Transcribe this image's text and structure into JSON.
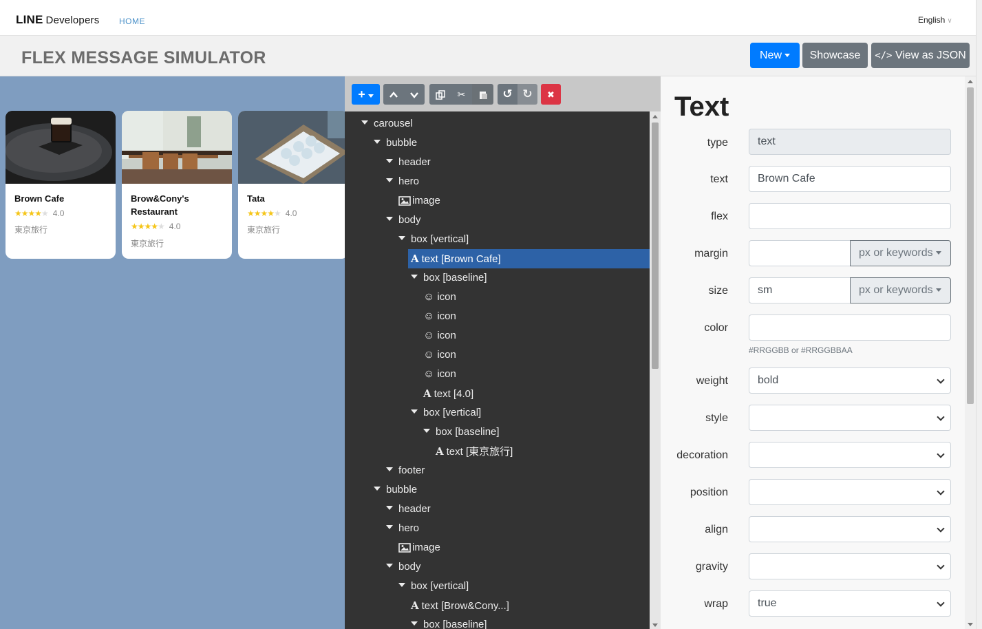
{
  "nav": {
    "brand": "LINE",
    "brand_sub": "Developers",
    "home": "HOME",
    "language": "English"
  },
  "header": {
    "title": "FLEX MESSAGE SIMULATOR",
    "new_label": "New",
    "showcase_label": "Showcase",
    "json_label": "View as JSON"
  },
  "preview": {
    "cards": [
      {
        "name": "Brown Cafe",
        "rating": "4.0",
        "stars_on": 4,
        "place": "東京旅行"
      },
      {
        "name": "Brow&Cony's Restaurant",
        "rating": "4.0",
        "stars_on": 4,
        "place": "東京旅行"
      },
      {
        "name": "Tata",
        "rating": "4.0",
        "stars_on": 4,
        "place": "東京旅行"
      }
    ]
  },
  "toolbar": {
    "add": "+",
    "up": "⌃",
    "down": "⌄",
    "copy": "⧉",
    "cut": "✂",
    "paste": "📋",
    "undo": "↺",
    "redo": "↻",
    "delete": "✖"
  },
  "tree": [
    {
      "label": "carousel",
      "kind": "group",
      "depth": 0
    },
    {
      "label": "bubble",
      "kind": "group",
      "depth": 1
    },
    {
      "label": "header",
      "kind": "group",
      "depth": 2
    },
    {
      "label": "hero",
      "kind": "group",
      "depth": 2
    },
    {
      "label": "image",
      "kind": "image",
      "depth": 3
    },
    {
      "label": "body",
      "kind": "group",
      "depth": 2
    },
    {
      "label": "box [vertical]",
      "kind": "group",
      "depth": 3
    },
    {
      "label": "text [Brown Cafe]",
      "kind": "text",
      "depth": 4,
      "selected": true
    },
    {
      "label": "box [baseline]",
      "kind": "group",
      "depth": 4
    },
    {
      "label": "icon",
      "kind": "icon",
      "depth": 5
    },
    {
      "label": "icon",
      "kind": "icon",
      "depth": 5
    },
    {
      "label": "icon",
      "kind": "icon",
      "depth": 5
    },
    {
      "label": "icon",
      "kind": "icon",
      "depth": 5
    },
    {
      "label": "icon",
      "kind": "icon",
      "depth": 5
    },
    {
      "label": "text [4.0]",
      "kind": "text",
      "depth": 5
    },
    {
      "label": "box [vertical]",
      "kind": "group",
      "depth": 4
    },
    {
      "label": "box [baseline]",
      "kind": "group",
      "depth": 5
    },
    {
      "label": "text [東京旅行]",
      "kind": "text",
      "depth": 6
    },
    {
      "label": "footer",
      "kind": "group",
      "depth": 2
    },
    {
      "label": "bubble",
      "kind": "group",
      "depth": 1
    },
    {
      "label": "header",
      "kind": "group",
      "depth": 2
    },
    {
      "label": "hero",
      "kind": "group",
      "depth": 2
    },
    {
      "label": "image",
      "kind": "image",
      "depth": 3
    },
    {
      "label": "body",
      "kind": "group",
      "depth": 2
    },
    {
      "label": "box [vertical]",
      "kind": "group",
      "depth": 3
    },
    {
      "label": "text [Brow&Cony...]",
      "kind": "text",
      "depth": 4
    },
    {
      "label": "box [baseline]",
      "kind": "group",
      "depth": 4
    }
  ],
  "props": {
    "heading": "Text",
    "type_label": "type",
    "type_value": "text",
    "text_label": "text",
    "text_value": "Brown Cafe",
    "flex_label": "flex",
    "flex_value": "",
    "margin_label": "margin",
    "margin_value": "",
    "margin_unit": "px or keywords",
    "size_label": "size",
    "size_value": "sm",
    "size_unit": "px or keywords",
    "color_label": "color",
    "color_value": "",
    "color_hint": "#RRGGBB or #RRGGBBAA",
    "weight_label": "weight",
    "weight_value": "bold",
    "style_label": "style",
    "style_value": "",
    "decoration_label": "decoration",
    "decoration_value": "",
    "position_label": "position",
    "position_value": "",
    "align_label": "align",
    "align_value": "",
    "gravity_label": "gravity",
    "gravity_value": "",
    "wrap_label": "wrap",
    "wrap_value": "true"
  }
}
